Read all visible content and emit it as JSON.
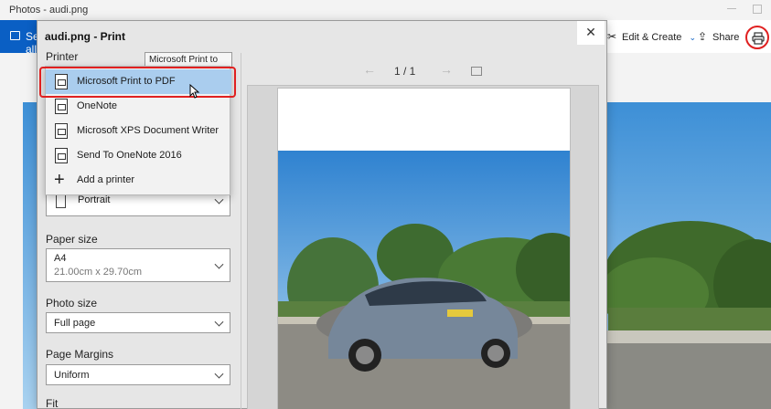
{
  "app": {
    "title": "Photos - audi.png"
  },
  "toolbar": {
    "see_all": "See all",
    "edit_create": "Edit & Create",
    "share": "Share",
    "print_icon": "printer-icon"
  },
  "dialog": {
    "title": "audi.png - Print",
    "close": "✕",
    "tooltip": "Microsoft Print to PDF",
    "printer_label": "Printer",
    "printers": [
      {
        "label": "Microsoft Print to PDF",
        "selected": true,
        "icon": "printer-icon"
      },
      {
        "label": "OneNote",
        "selected": false,
        "icon": "printer-icon"
      },
      {
        "label": "Microsoft XPS Document Writer",
        "selected": false,
        "icon": "printer-icon"
      },
      {
        "label": "Send To OneNote 2016",
        "selected": false,
        "icon": "printer-icon"
      }
    ],
    "add_printer": "Add a printer",
    "orientation_value": "Portrait",
    "paper_size_label": "Paper size",
    "paper_size_value": "A4",
    "paper_size_detail": "21.00cm x 29.70cm",
    "photo_size_label": "Photo size",
    "photo_size_value": "Full page",
    "page_margins_label": "Page Margins",
    "page_margins_value": "Uniform",
    "fit_label": "Fit",
    "page_counter": "1 / 1"
  },
  "colors": {
    "accent": "#0a5fc4",
    "selection": "#aacdee",
    "highlight_ring": "#e02020"
  }
}
